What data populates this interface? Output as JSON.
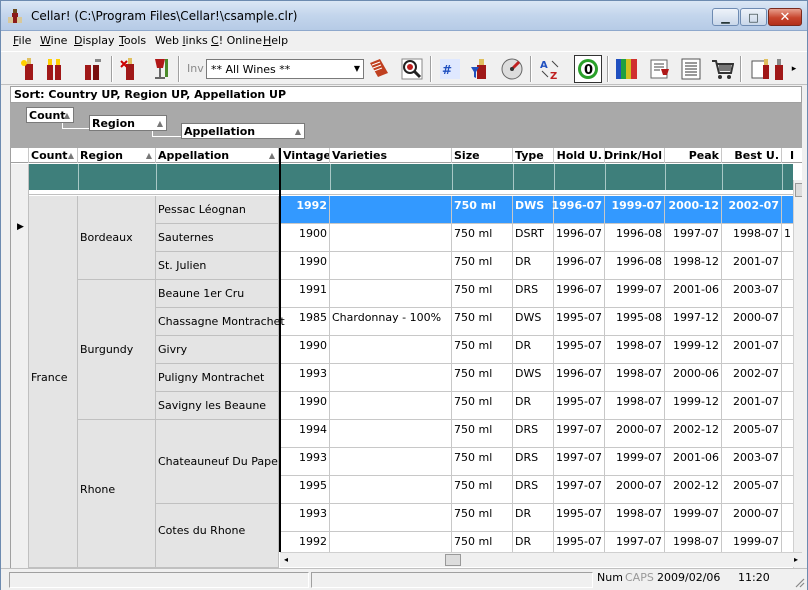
{
  "window": {
    "title": "Cellar! (C:\\Program Files\\Cellar!\\csample.clr)"
  },
  "menu": [
    {
      "pre": "",
      "key": "F",
      "post": "ile"
    },
    {
      "pre": "",
      "key": "W",
      "post": "ine"
    },
    {
      "pre": "",
      "key": "D",
      "post": "isplay"
    },
    {
      "pre": "",
      "key": "T",
      "post": "ools"
    },
    {
      "pre": "Web ",
      "key": "l",
      "post": "inks"
    },
    {
      "pre": "",
      "key": "C",
      "post": "! Online"
    },
    {
      "pre": "",
      "key": "H",
      "post": "elp"
    }
  ],
  "toolbar": {
    "inv_label": "Inv",
    "filter_value": "** All Wines **"
  },
  "sort_text": "Sort: Country UP, Region UP, Appellation UP",
  "group_chips": [
    "Count",
    "Region",
    "Appellation"
  ],
  "columns": [
    "Count",
    "Region",
    "Appellation",
    "Vintage",
    "Varieties",
    "Size",
    "Type",
    "Hold U.",
    "Drink/Hol",
    "Peak",
    "Best U.",
    "I"
  ],
  "country": "France",
  "regions": [
    "Bordeaux",
    "Burgundy",
    "Rhone"
  ],
  "appellations": [
    "Pessac Léognan",
    "Sauternes",
    "St. Julien",
    "Beaune 1er Cru",
    "Chassagne Montrachet",
    "Givry",
    "Puligny Montrachet",
    "Savigny les Beaune",
    "Chateauneuf Du Pape",
    "Cotes du Rhone"
  ],
  "rows": [
    {
      "vintage": "1992",
      "varieties": "",
      "size": "750 ml",
      "type": "DWS",
      "hold": "1996-07",
      "drink": "1999-07",
      "peak": "2000-12",
      "best": "2002-07",
      "extra": ""
    },
    {
      "vintage": "1900",
      "varieties": "",
      "size": "750 ml",
      "type": "DSRT",
      "hold": "1996-07",
      "drink": "1996-08",
      "peak": "1997-07",
      "best": "1998-07",
      "extra": "1"
    },
    {
      "vintage": "1990",
      "varieties": "",
      "size": "750 ml",
      "type": "DR",
      "hold": "1996-07",
      "drink": "1996-08",
      "peak": "1998-12",
      "best": "2001-07",
      "extra": ""
    },
    {
      "vintage": "1991",
      "varieties": "",
      "size": "750 ml",
      "type": "DRS",
      "hold": "1996-07",
      "drink": "1999-07",
      "peak": "2001-06",
      "best": "2003-07",
      "extra": ""
    },
    {
      "vintage": "1985",
      "varieties": "Chardonnay - 100%",
      "size": "750 ml",
      "type": "DWS",
      "hold": "1995-07",
      "drink": "1995-08",
      "peak": "1997-12",
      "best": "2000-07",
      "extra": ""
    },
    {
      "vintage": "1990",
      "varieties": "",
      "size": "750 ml",
      "type": "DR",
      "hold": "1995-07",
      "drink": "1998-07",
      "peak": "1999-12",
      "best": "2001-07",
      "extra": ""
    },
    {
      "vintage": "1993",
      "varieties": "",
      "size": "750 ml",
      "type": "DWS",
      "hold": "1996-07",
      "drink": "1998-07",
      "peak": "2000-06",
      "best": "2002-07",
      "extra": ""
    },
    {
      "vintage": "1990",
      "varieties": "",
      "size": "750 ml",
      "type": "DR",
      "hold": "1995-07",
      "drink": "1998-07",
      "peak": "1999-12",
      "best": "2001-07",
      "extra": ""
    },
    {
      "vintage": "1994",
      "varieties": "",
      "size": "750 ml",
      "type": "DRS",
      "hold": "1997-07",
      "drink": "2000-07",
      "peak": "2002-12",
      "best": "2005-07",
      "extra": ""
    },
    {
      "vintage": "1993",
      "varieties": "",
      "size": "750 ml",
      "type": "DRS",
      "hold": "1997-07",
      "drink": "1999-07",
      "peak": "2001-06",
      "best": "2003-07",
      "extra": ""
    },
    {
      "vintage": "1995",
      "varieties": "",
      "size": "750 ml",
      "type": "DRS",
      "hold": "1997-07",
      "drink": "2000-07",
      "peak": "2002-12",
      "best": "2005-07",
      "extra": ""
    },
    {
      "vintage": "1993",
      "varieties": "",
      "size": "750 ml",
      "type": "DR",
      "hold": "1995-07",
      "drink": "1998-07",
      "peak": "1999-07",
      "best": "2000-07",
      "extra": ""
    },
    {
      "vintage": "1992",
      "varieties": "",
      "size": "750 ml",
      "type": "DR",
      "hold": "1995-07",
      "drink": "1997-07",
      "peak": "1998-07",
      "best": "1999-07",
      "extra": ""
    }
  ],
  "status": {
    "num": "Num",
    "caps": "CAPS",
    "date": "2009/02/06",
    "time": "11:20"
  },
  "colors": {
    "selection": "#3399ff",
    "group_row": "#3e7f7b",
    "group_cell": "#e4e4e4"
  }
}
